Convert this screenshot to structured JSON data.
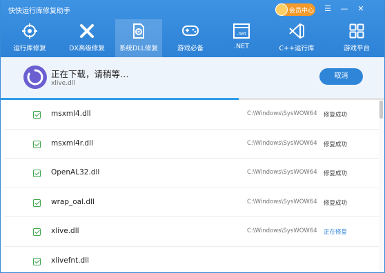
{
  "app": {
    "title": "快快运行库修复助手"
  },
  "vip": {
    "label": "会员中心"
  },
  "window_controls": {
    "menu": "☰",
    "minimize": "—",
    "close": "✕"
  },
  "tabs": [
    {
      "label": "运行库修复",
      "icon": "crosshair-icon"
    },
    {
      "label": "DX高级修复",
      "icon": "x-icon"
    },
    {
      "label": "系统DLL修复",
      "icon": "gear-file-icon",
      "active": true
    },
    {
      "label": "游戏必备",
      "icon": "gamepad-icon"
    },
    {
      "label": ".NET",
      "icon": "net-window-icon"
    },
    {
      "label": "C++运行库",
      "icon": "visual-studio-icon"
    },
    {
      "label": "游戏平台",
      "icon": "grid-icon"
    }
  ],
  "download": {
    "title": "正在下载，请稍等…",
    "file": "xlive.dll",
    "cancel_label": "取消",
    "progress": 0.62
  },
  "list": [
    {
      "name": "msxml4.dll",
      "path": "C:\\Windows\\SysWOW64",
      "status": "修复成功",
      "state": "done"
    },
    {
      "name": "msxml4r.dll",
      "path": "C:\\Windows\\SysWOW64",
      "status": "修复成功",
      "state": "done"
    },
    {
      "name": "OpenAL32.dll",
      "path": "C:\\Windows\\SysWOW64",
      "status": "修复成功",
      "state": "done"
    },
    {
      "name": "wrap_oal.dll",
      "path": "C:\\Windows\\SysWOW64",
      "status": "修复成功",
      "state": "done"
    },
    {
      "name": "xlive.dll",
      "path": "C:\\Windows\\SysWOW64",
      "status": "正在修复",
      "state": "active"
    },
    {
      "name": "xlivefnt.dll",
      "path": "",
      "status": "",
      "state": "pending"
    }
  ],
  "colors": {
    "header": "#2e82d6",
    "accent": "#2f86d9",
    "check": "#3fa64b",
    "vip": "#f39a2a"
  }
}
